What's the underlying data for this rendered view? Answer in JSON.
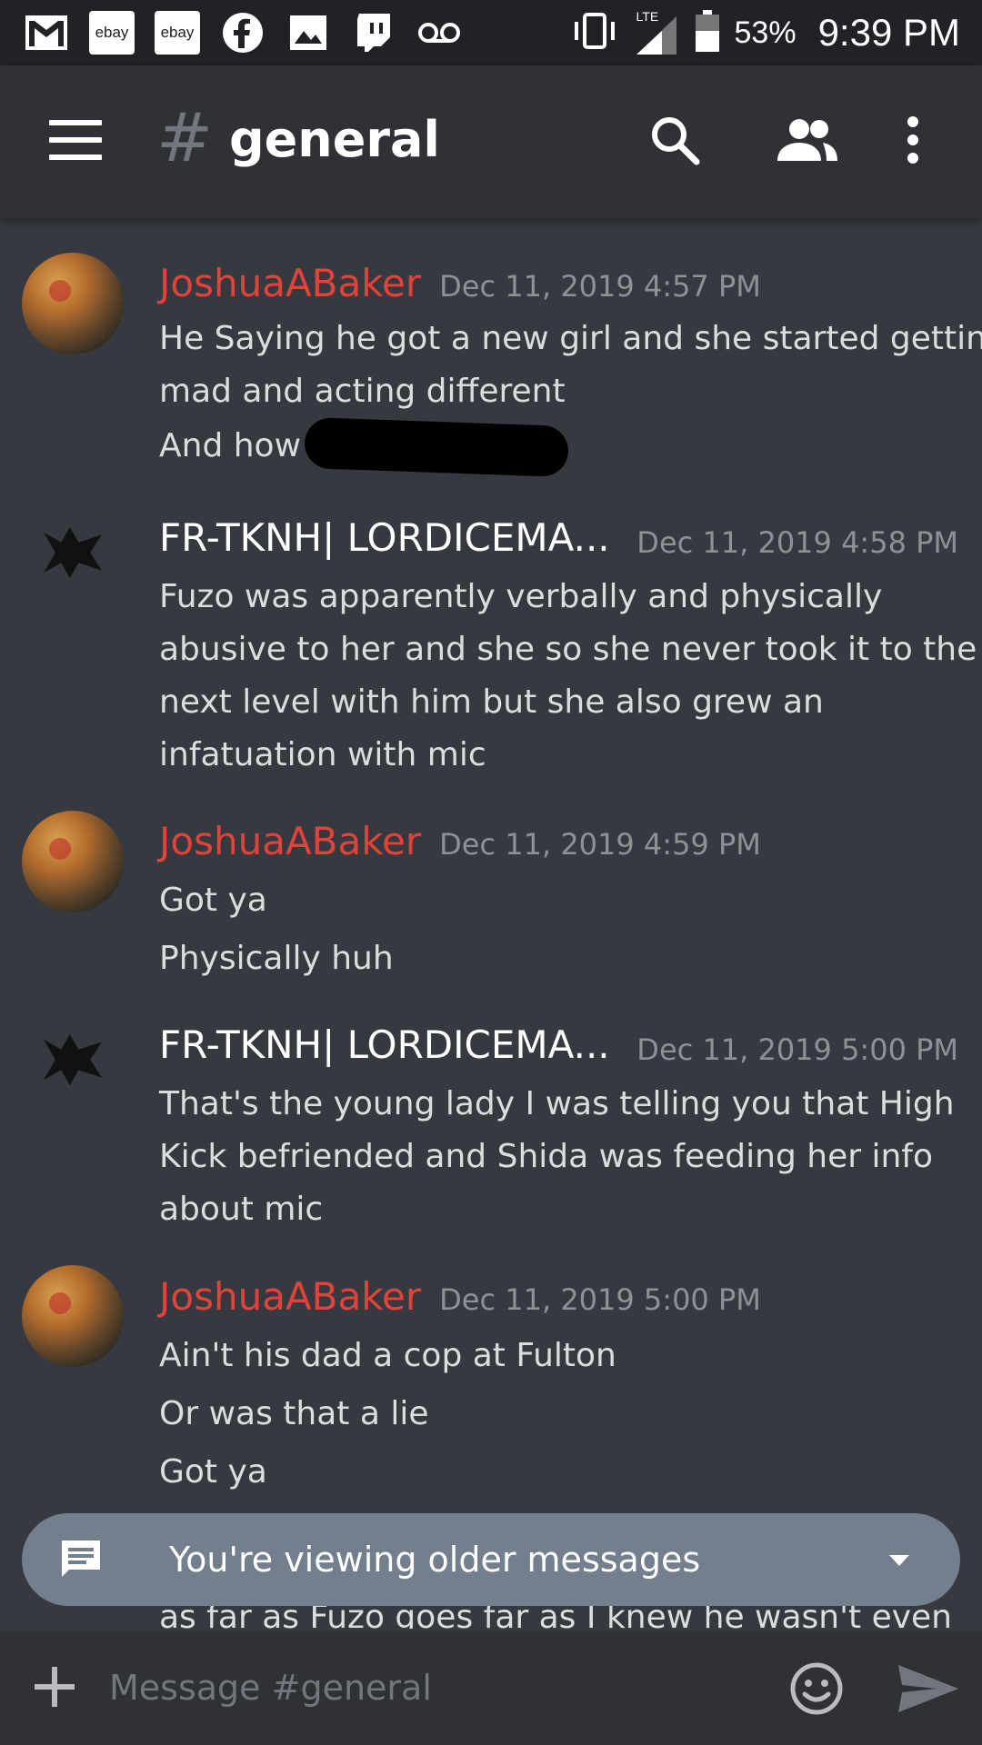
{
  "status_bar": {
    "icons": [
      "gmail-icon",
      "ebay-icon",
      "ebay-icon",
      "facebook-icon",
      "gallery-icon",
      "twitch-icon",
      "voicemail-icon"
    ],
    "ebay_label": "ebay",
    "network": "LTE",
    "battery_percent": "53%",
    "time": "9:39 PM"
  },
  "header": {
    "hash_symbol": "#",
    "channel_name": "general"
  },
  "messages": [
    {
      "author": "JoshuaABaker",
      "timestamp": "Dec 11, 2019 4:57 PM",
      "lines": [
        "He Saying he got a new girl and she started getting",
        "mad and acting different",
        "And how"
      ]
    },
    {
      "author": "FR-TKNH| LORDICEMA...",
      "timestamp": "Dec 11, 2019 4:58 PM",
      "lines": [
        "Fuzo was apparently verbally and physically",
        "abusive to her and she so she never took it to the",
        "next level with him but she also grew an",
        "infatuation with mic"
      ]
    },
    {
      "author": "JoshuaABaker",
      "timestamp": "Dec 11, 2019 4:59 PM",
      "lines": [
        "Got ya",
        "Physically huh"
      ]
    },
    {
      "author": "FR-TKNH| LORDICEMA...",
      "timestamp": "Dec 11, 2019 5:00 PM",
      "lines": [
        "That's the young lady I was telling you that High",
        "Kick befriended and Shida was feeding her info",
        "about mic"
      ]
    },
    {
      "author": "JoshuaABaker",
      "timestamp": "Dec 11, 2019 5:00 PM",
      "lines": [
        "Ain't his dad a cop at Fulton",
        "Or was that a lie",
        "Got ya"
      ]
    }
  ],
  "older_banner": {
    "text": "You're viewing older messages"
  },
  "peek_line": "as far as Fuzo goes far as I knew he wasn't even",
  "composer": {
    "placeholder": "Message #general"
  },
  "colors": {
    "background": "#36393f",
    "header": "#2f3136",
    "author_red": "#e0433a",
    "timestamp": "#8e9297",
    "banner": "#747f8d"
  }
}
